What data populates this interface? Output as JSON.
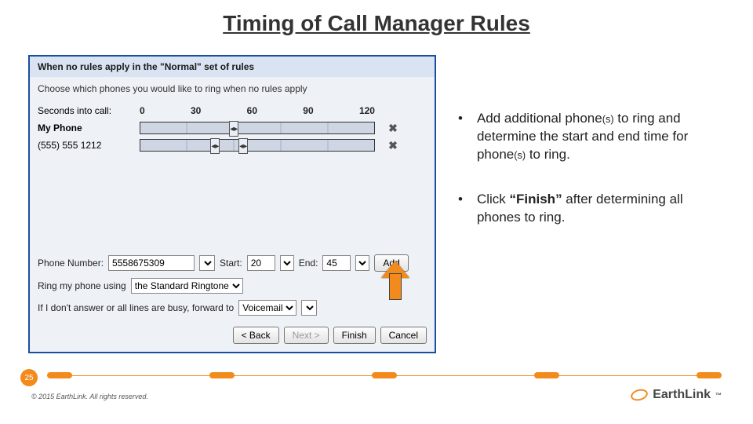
{
  "title": "Timing of Call Manager Rules",
  "panel": {
    "header": "When no rules apply in the \"Normal\" set of rules",
    "subtext": "Choose which phones you would like to ring when no rules apply",
    "seconds_label": "Seconds into call:",
    "ticks": [
      "0",
      "30",
      "60",
      "90",
      "120"
    ],
    "rows": [
      {
        "label": "My Phone",
        "bold": true,
        "handles_pct": [
          38
        ]
      },
      {
        "label": "(555) 555 1212",
        "bold": false,
        "handles_pct": [
          30,
          42
        ]
      }
    ],
    "phone_number_label": "Phone Number:",
    "phone_number_value": "5558675309",
    "start_label": "Start:",
    "start_value": "20",
    "end_label": "End:",
    "end_value": "45",
    "add_label": "Add",
    "ringtone_label": "Ring my phone using",
    "ringtone_value": "the Standard Ringtone",
    "noanswer_label": "If I don't answer or all lines are busy, forward to",
    "noanswer_value": "Voicemail",
    "btn_back": "< Back",
    "btn_next": "Next >",
    "btn_finish": "Finish",
    "btn_cancel": "Cancel"
  },
  "notes": {
    "a_pre": "Add additional phone",
    "a_small": "(s)",
    "a_mid": " to ring and determine the start and end time for phone",
    "a_small2": "(s)",
    "a_post": " to ring.",
    "b_pre": "Click ",
    "b_bold": "“Finish”",
    "b_post": " after determining all phones to ring."
  },
  "footer": {
    "page": "25",
    "copyright": "© 2015 EarthLink. All rights reserved.",
    "brand": "EarthLink"
  },
  "colors": {
    "accent": "#f28a1c",
    "panel_border": "#1a4ea0"
  }
}
